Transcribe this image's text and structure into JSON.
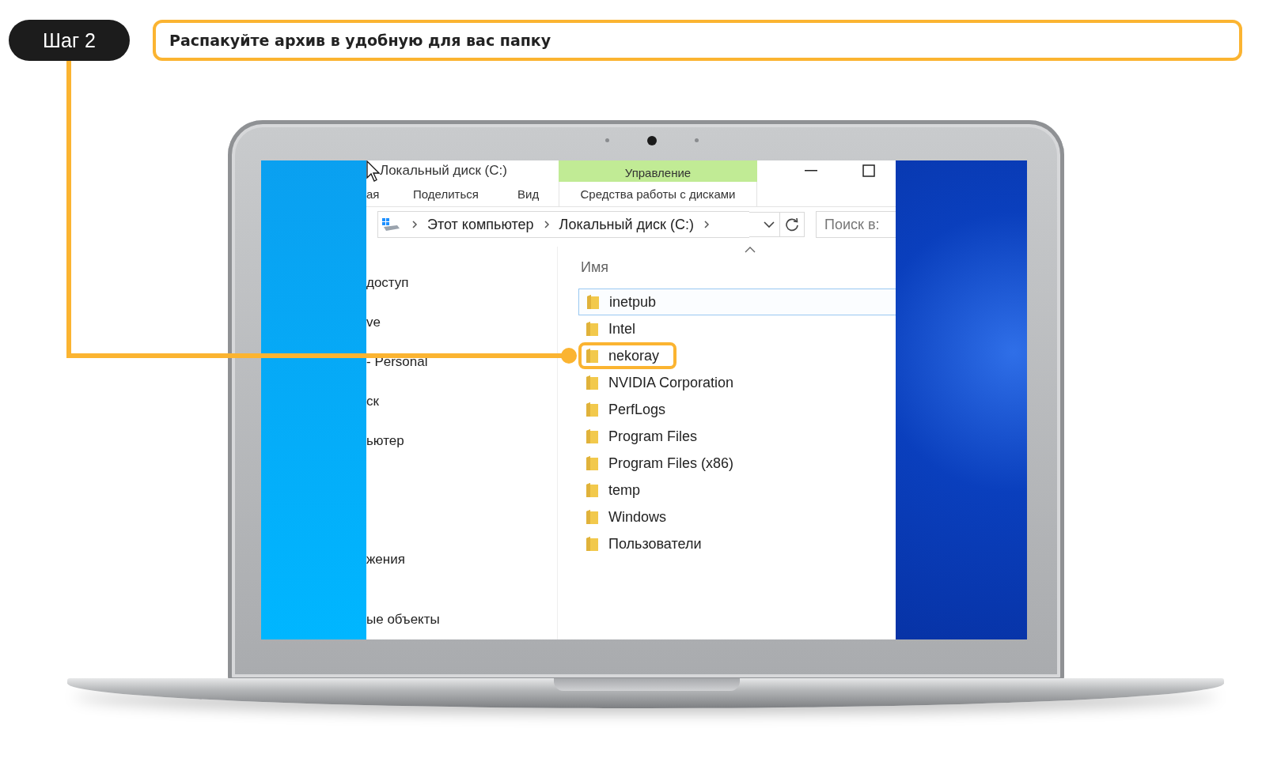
{
  "step": {
    "label": "Шаг 2",
    "instruction": "Распакуйте архив в удобную для вас папку"
  },
  "window": {
    "title": "Локальный диск (C:)",
    "context_tab": "Управление"
  },
  "ribbon_tabs": [
    {
      "label": "ая",
      "kind": "plain"
    },
    {
      "label": "Поделиться",
      "kind": "plain"
    },
    {
      "label": "Вид",
      "kind": "plain"
    },
    {
      "label": "Средства работы с дисками",
      "kind": "context"
    }
  ],
  "address_bar": {
    "segments": [
      "Этот компьютер",
      "Локальный диск (C:)"
    ]
  },
  "search": {
    "placeholder": "Поиск в:"
  },
  "nav_pane": {
    "items": [
      "доступ",
      "ve",
      "- Personal",
      "ск",
      "ьютер",
      "жения",
      "ые объекты"
    ]
  },
  "file_list": {
    "column": "Имя",
    "items": [
      {
        "name": "inetpub",
        "hovered": true,
        "highlighted": false
      },
      {
        "name": "Intel",
        "hovered": false,
        "highlighted": false
      },
      {
        "name": "nekoray",
        "hovered": false,
        "highlighted": true
      },
      {
        "name": "NVIDIA Corporation",
        "hovered": false,
        "highlighted": false
      },
      {
        "name": "PerfLogs",
        "hovered": false,
        "highlighted": false
      },
      {
        "name": "Program Files",
        "hovered": false,
        "highlighted": false
      },
      {
        "name": "Program Files (x86)",
        "hovered": false,
        "highlighted": false
      },
      {
        "name": "temp",
        "hovered": false,
        "highlighted": false
      },
      {
        "name": "Windows",
        "hovered": false,
        "highlighted": false
      },
      {
        "name": "Пользователи",
        "hovered": false,
        "highlighted": false
      }
    ]
  }
}
